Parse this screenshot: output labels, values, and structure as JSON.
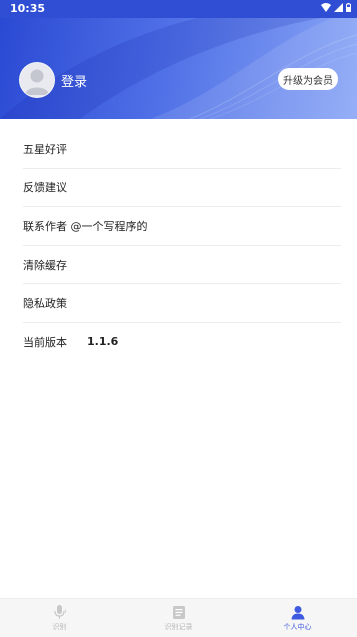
{
  "status_bar": {
    "time": "10:35"
  },
  "profile": {
    "login_label": "登录",
    "upgrade_label": "升级为会员"
  },
  "menu": [
    {
      "label": "五星好评"
    },
    {
      "label": "反馈建议"
    },
    {
      "label": "联系作者 @一个写程序的"
    },
    {
      "label": "清除缓存"
    },
    {
      "label": "隐私政策"
    },
    {
      "label": "当前版本",
      "value": "1.1.6"
    }
  ],
  "tabbar": [
    {
      "label": "识别",
      "icon": "microphone-icon"
    },
    {
      "label": "识别记录",
      "icon": "document-icon"
    },
    {
      "label": "个人中心",
      "icon": "person-icon",
      "active": true
    }
  ],
  "colors": {
    "accent": "#3d5ae0",
    "header_start": "#2a49d3",
    "header_end": "#8aa6f6"
  }
}
